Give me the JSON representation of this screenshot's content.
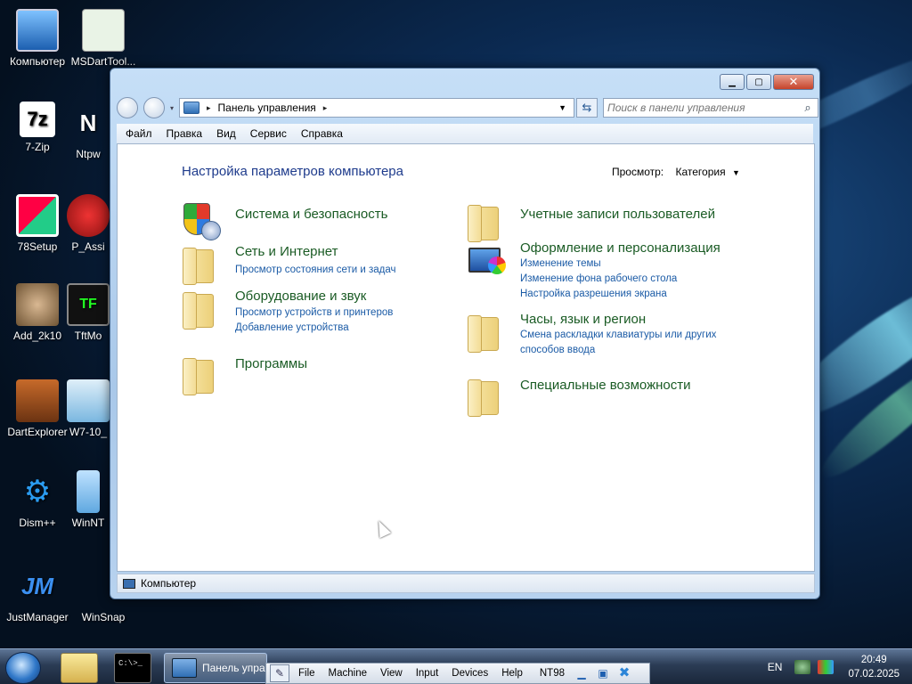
{
  "desktop": {
    "icons": [
      {
        "label": "Компьютер",
        "icon": "computer-icon"
      },
      {
        "label": "MSDartTool...",
        "icon": "msdart-icon"
      },
      {
        "label": "7-Zip",
        "icon": "7zip-icon",
        "glyph": "7z"
      },
      {
        "label": "Ntpw",
        "icon": "ntpw-icon",
        "glyph": "N"
      },
      {
        "label": "78Setup",
        "icon": "setup-icon"
      },
      {
        "label": "P_Assi",
        "icon": "passist-icon"
      },
      {
        "label": "Add_2k10",
        "icon": "dog-photo-icon"
      },
      {
        "label": "TftMo",
        "icon": "tft-icon",
        "glyph": "TF"
      },
      {
        "label": "DartExplorer",
        "icon": "dart-explorer-icon"
      },
      {
        "label": "W7-10_",
        "icon": "w7-icon"
      },
      {
        "label": "Dism++",
        "icon": "gears-icon"
      },
      {
        "label": "WinNT",
        "icon": "winnt-icon"
      },
      {
        "label": "JustManager",
        "icon": "justmanager-icon",
        "glyph": "JM"
      },
      {
        "label": "WinSnap",
        "icon": "winsnap-icon"
      }
    ]
  },
  "window": {
    "address": {
      "root_arrow": "▸",
      "location": "Панель управления",
      "arrow": "▸"
    },
    "search": {
      "placeholder": "Поиск в панели управления"
    },
    "menu": [
      "Файл",
      "Правка",
      "Вид",
      "Сервис",
      "Справка"
    ],
    "title": "Настройка параметров компьютера",
    "view": {
      "label": "Просмотр:",
      "value": "Категория"
    },
    "categories": [
      {
        "name": "Система и безопасность",
        "icon": "shield-icon",
        "links": []
      },
      {
        "name": "Сеть и Интернет",
        "icon": "folder-icon",
        "links": [
          "Просмотр состояния сети и задач"
        ]
      },
      {
        "name": "Оборудование и звук",
        "icon": "folder-icon",
        "links": [
          "Просмотр устройств и принтеров",
          "Добавление устройства"
        ]
      },
      {
        "name": "Программы",
        "icon": "folder-icon",
        "links": []
      },
      {
        "name": "Учетные записи пользователей",
        "icon": "folder-icon",
        "links": []
      },
      {
        "name": "Оформление и персонализация",
        "icon": "monitor-palette-icon",
        "links": [
          "Изменение темы",
          "Изменение фона рабочего стола",
          "Настройка разрешения экрана"
        ]
      },
      {
        "name": "Часы, язык и регион",
        "icon": "folder-icon",
        "links": [
          "Смена раскладки клавиатуры или других способов ввода"
        ]
      },
      {
        "name": "Специальные возможности",
        "icon": "folder-icon",
        "links": []
      }
    ],
    "status": "Компьютер"
  },
  "taskbar": {
    "cmd_text": "C:\\>_",
    "active_task": "Панель упра",
    "vm_menu": [
      "File",
      "Machine",
      "View",
      "Input",
      "Devices",
      "Help"
    ],
    "vm_name": "NT98",
    "lang": "EN",
    "time": "20:49",
    "date": "07.02.2025"
  }
}
